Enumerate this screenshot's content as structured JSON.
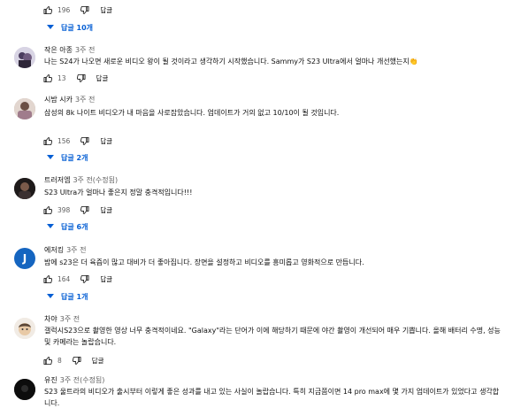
{
  "top": {
    "likes": "196",
    "reply_label": "답글",
    "replies_label": "답글 10개"
  },
  "comments": [
    {
      "author": "작은 아종",
      "time": "3주 전",
      "text": "나는 S24가 나오면 새로운 비디오 왕이 될 것이라고 생각하기 시작했습니다. Sammy가 S23 Ultra에서 얼마나 개선했는지👏",
      "likes": "13",
      "reply_label": "답글"
    },
    {
      "author": "시밤 시카",
      "time": "3주 전",
      "text": "삼성의 8k 나이트 비디오가 내 마음을 사로잡았습니다. 업데이트가 거의 없고 10/10이 될 것입니다.",
      "likes": "156",
      "reply_label": "답글",
      "replies_label": "답글 2개"
    },
    {
      "author": "트러저엠",
      "time": "3주 전(수정됨)",
      "text": "S23 Ultra가 얼마나 좋은지 정말 충격적입니다!!!",
      "likes": "398",
      "reply_label": "답글",
      "replies_label": "답글 6개"
    },
    {
      "author": "에저킹",
      "time": "3주 전",
      "avatar_letter": "J",
      "text": "밤에 s23은 더 육즙이 많고 대비가 더 좋아집니다. 장면을 설정하고 비디오를 흥미롭고 영화적으로 만듭니다.",
      "likes": "164",
      "reply_label": "답글",
      "replies_label": "답글 1개"
    },
    {
      "author": "차야",
      "time": "3주 전",
      "text": "갤럭시S23으로 촬영한 영상 너무 충격적이네요. \"Galaxy\"라는 단어가 이에 해당하기 때문에 야간 촬영이 개선되어 매우 기쁩니다. 올해 배터리 수명, 성능 및 카메라는 놀랍습니다.",
      "likes": "8",
      "reply_label": "답글"
    },
    {
      "author": "유진",
      "time": "3주 전(수정됨)",
      "text": "S23 울트라의 비디오가 출시부터 이렇게 좋은 성과를 내고 있는 사실이 놀랍습니다. 특히 지금쯤이면 14 pro max에 몇 가지 업데이트가 있었다고 생각합니다."
    }
  ],
  "colors": {
    "link": "#065fd4",
    "muted": "#606060",
    "text": "#0f0f0f",
    "avatar_j": "#1565c0"
  },
  "icons": [
    "thumbs-up-icon",
    "thumbs-down-icon",
    "chevron-down-icon"
  ]
}
